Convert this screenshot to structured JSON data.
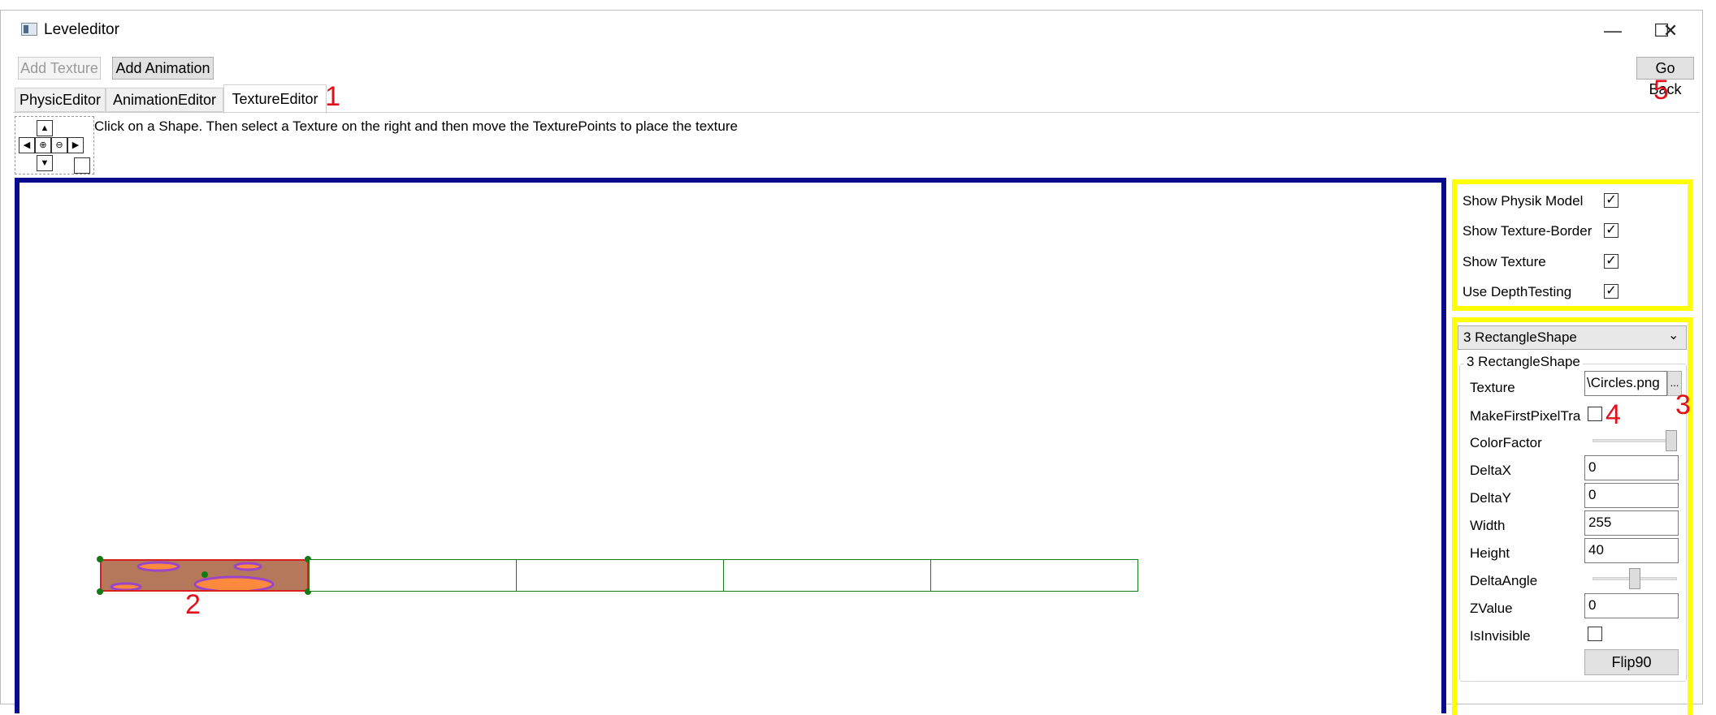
{
  "window": {
    "title": "Leveleditor",
    "minimize": "—",
    "maximize": "☐",
    "close": "✕"
  },
  "toolbar": {
    "add_texture": "Add Texture",
    "add_animation": "Add Animation",
    "go_back": "Go Back"
  },
  "tabs": [
    {
      "label": "PhysicEditor"
    },
    {
      "label": "AnimationEditor"
    },
    {
      "label": "TextureEditor",
      "active": true
    }
  ],
  "instructions": "Click on a Shape. Then select a Texture on the right and then move the TexturePoints to place the texture",
  "annotations": {
    "n1": "1",
    "n2": "2",
    "n3": "3",
    "n4": "4",
    "n5": "5"
  },
  "nav_icons": {
    "up": "▲",
    "left": "◀",
    "zoom_in": "⊕",
    "zoom_out": "⊖",
    "right": "▶",
    "down": "▼"
  },
  "display_options": [
    {
      "label": "Show Physik Model",
      "checked": true
    },
    {
      "label": "Show Texture-Border",
      "checked": true
    },
    {
      "label": "Show Texture",
      "checked": true
    },
    {
      "label": "Use DepthTesting",
      "checked": true
    }
  ],
  "shape_selector": {
    "value": "3 RectangleShape",
    "chevron": "⌄"
  },
  "properties": {
    "group_title": "3 RectangleShape",
    "texture_label": "Texture",
    "texture_value": "\\Circles.png",
    "browse": "...",
    "make_first_pixel_label": "MakeFirstPixelTra",
    "make_first_pixel_checked": false,
    "color_factor_label": "ColorFactor",
    "color_factor_level": 1.0,
    "delta_x_label": "DeltaX",
    "delta_x": "0",
    "delta_y_label": "DeltaY",
    "delta_y": "0",
    "width_label": "Width",
    "width": "255",
    "height_label": "Height",
    "height": "40",
    "delta_angle_label": "DeltaAngle",
    "delta_angle_level": 0.5,
    "z_label": "ZValue",
    "z_value": "0",
    "invisible_label": "IsInvisible",
    "invisible_checked": false,
    "flip_button": "Flip90"
  },
  "colors": {
    "canvas_border": "#0a0a8c",
    "highlight": "#ffff00",
    "shape_outline": "#1a7a1a",
    "annotation": "#e0111b",
    "texture_fill": "#b5785a"
  }
}
